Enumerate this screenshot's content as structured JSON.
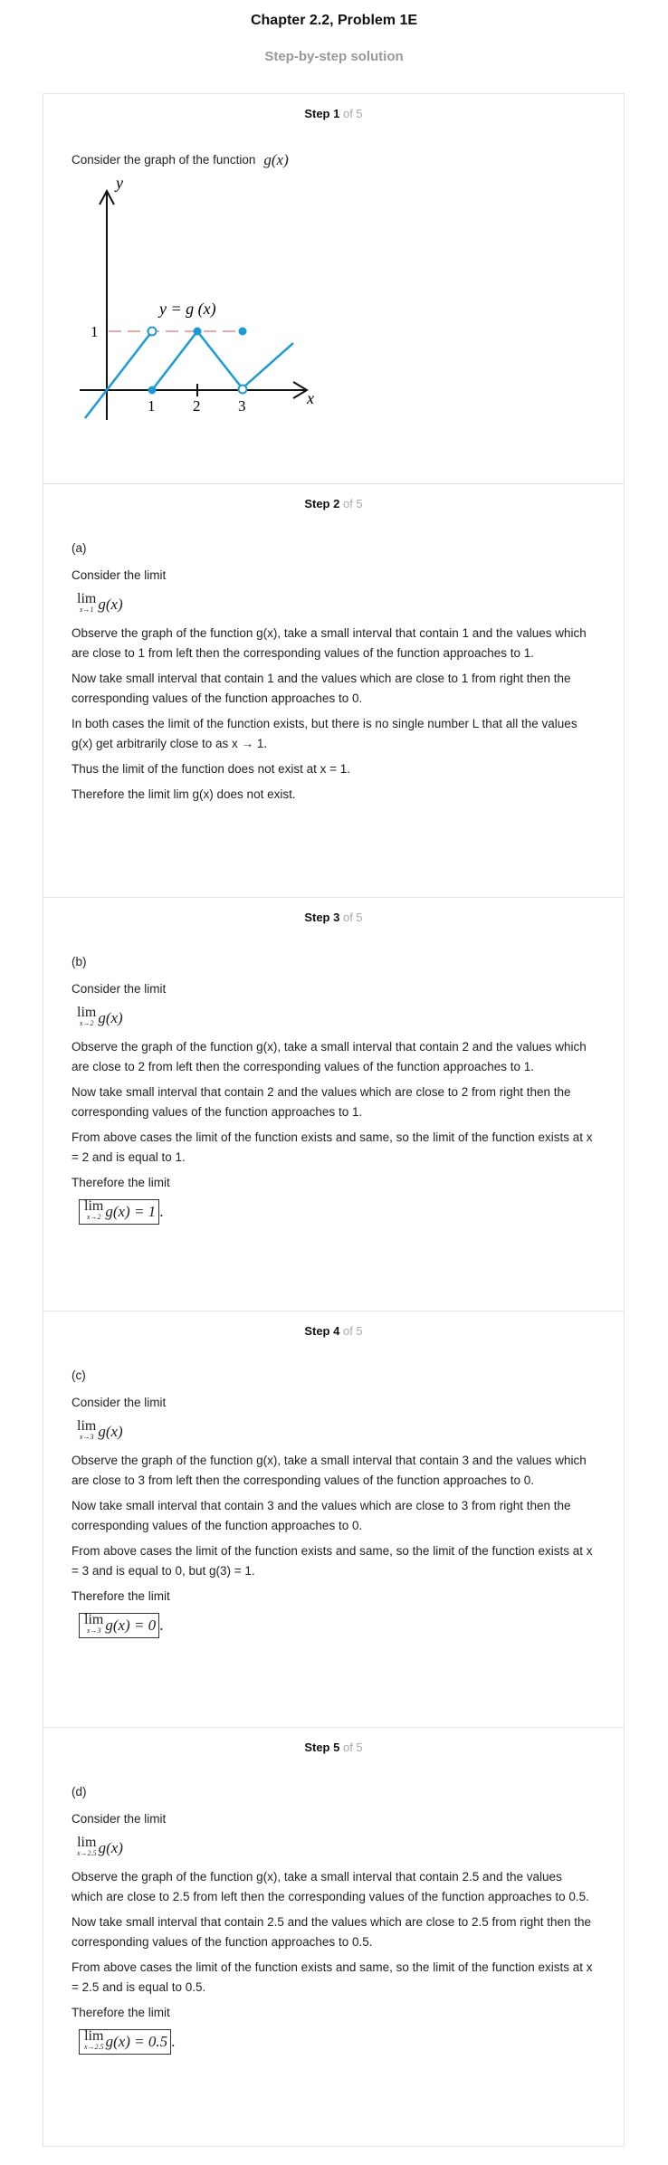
{
  "header": {
    "title": "Chapter 2.2, Problem 1E",
    "subtitle": "Step-by-step solution"
  },
  "steps": [
    {
      "label": "Step 1",
      "of": "of 5",
      "intro": "Consider the graph of the function",
      "fn": "g(x)",
      "graph": {
        "y_axis_label": "y",
        "x_axis_label": "x",
        "curve_label": "y = g (x)",
        "y_tick": "1",
        "x_ticks": [
          "1",
          "2",
          "3"
        ]
      }
    },
    {
      "label": "Step 2",
      "of": "of 5",
      "part": "(a)",
      "consider": "Consider the limit",
      "lim_sub": "x→1",
      "lines": [
        "Observe the graph of the function g(x), take a small interval that contain 1 and the values which are close to 1 from left then the corresponding values of the function approaches to 1.",
        "Now take small interval that contain 1 and the values which are close to 1 from right then the corresponding values of the function approaches to 0.",
        "In both cases the limit of the function exists, but there is no single number L that all the values g(x) get arbitrarily close to as x → 1.",
        "Thus the limit of the function does not exist at x = 1.",
        "Therefore the limit lim g(x) does not exist."
      ]
    },
    {
      "label": "Step 3",
      "of": "of 5",
      "part": "(b)",
      "consider": "Consider the limit",
      "lim_sub": "x→2",
      "lines": [
        "Observe the graph of the function g(x), take a small interval that contain 2 and the values which are close to 2 from left then the corresponding values of the function approaches to 1.",
        "Now take small interval that contain 2 and the values which are close to 2 from right then the corresponding values of the function approaches to 1.",
        "From above cases the limit of the function exists and same, so the limit of the function exists at x = 2 and is equal to 1.",
        "Therefore the limit"
      ],
      "answer": "g(x) = 1"
    },
    {
      "label": "Step 4",
      "of": "of 5",
      "part": "(c)",
      "consider": "Consider the limit",
      "lim_sub": "x→3",
      "lines": [
        "Observe the graph of the function g(x), take a small interval that contain 3 and the values which are close to 3 from left then the corresponding values of the function approaches to 0.",
        "Now take small interval that contain 3 and the values which are close to 3 from right then the corresponding values of the function approaches to 0.",
        "From above cases the limit of the function exists and same, so the limit of the function exists at x = 3 and is equal to 0, but g(3) = 1.",
        "Therefore the limit"
      ],
      "answer": "g(x) = 0"
    },
    {
      "label": "Step 5",
      "of": "of 5",
      "part": "(d)",
      "consider": "Consider the limit",
      "lim_sub": "x→2.5",
      "lines": [
        "Observe the graph of the function g(x), take a small interval that contain 2.5 and the values which are close to 2.5 from left then the corresponding values of the function approaches to 0.5.",
        "Now take small interval that contain 2.5 and the values which are close to 2.5 from right then the corresponding values of the function approaches to 0.5.",
        "From above cases the limit of the function exists and same, so the limit of the function exists at x = 2.5 and is equal to 0.5.",
        "Therefore the limit"
      ],
      "answer": "g(x) = 0.5"
    }
  ],
  "lim_word": "lim",
  "colors": {
    "curve": "#1c9ad6",
    "dashed": "#d9534f",
    "step_of": "#aaaaaa",
    "subtitle": "#999999"
  }
}
